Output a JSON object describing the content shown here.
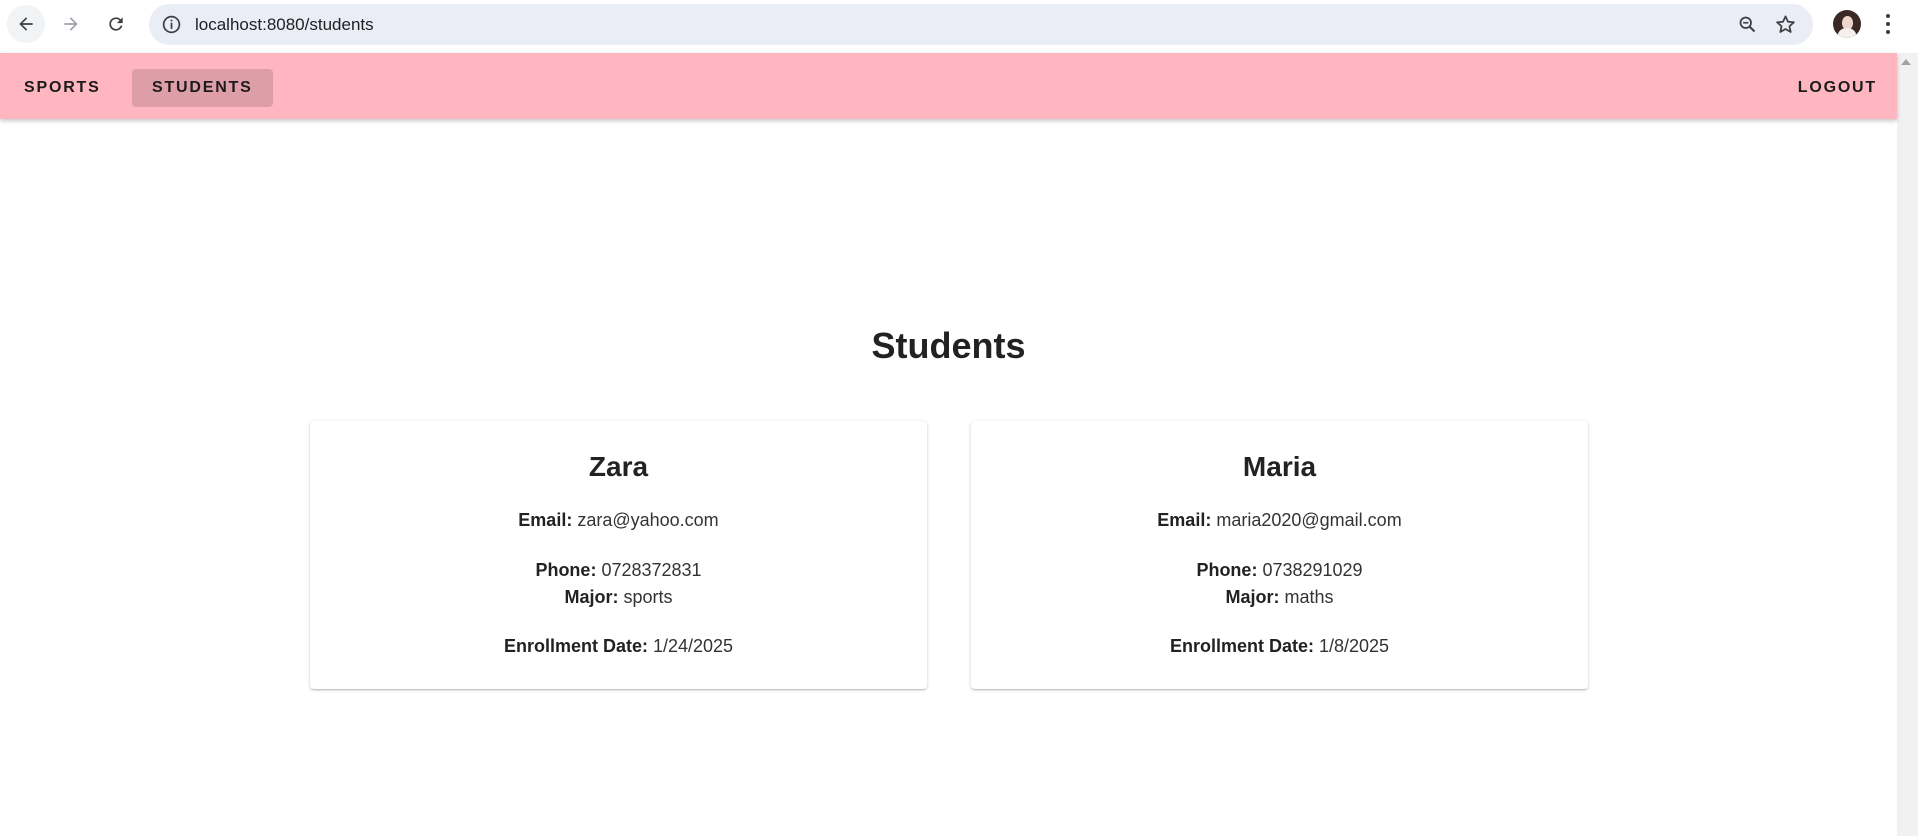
{
  "browser": {
    "url": "localhost:8080/students",
    "icons": [
      "back-arrow-icon",
      "forward-arrow-icon",
      "reload-icon",
      "info-icon",
      "zoom-icon",
      "star-icon",
      "kebab-menu-icon"
    ]
  },
  "appbar": {
    "background": "#ffb6c1",
    "sports_label": "SPORTS",
    "students_label": "STUDENTS",
    "logout_label": "LOGOUT"
  },
  "main": {
    "title": "Students",
    "labels": {
      "email": "Email:",
      "phone": "Phone:",
      "major": "Major:",
      "enrollment": "Enrollment Date:"
    },
    "students": [
      {
        "name": "Zara",
        "email": "zara@yahoo.com",
        "phone": "0728372831",
        "major": "sports",
        "enrollment_date": "1/24/2025"
      },
      {
        "name": "Maria",
        "email": "maria2020@gmail.com",
        "phone": "0738291029",
        "major": "maths",
        "enrollment_date": "1/8/2025"
      }
    ]
  }
}
